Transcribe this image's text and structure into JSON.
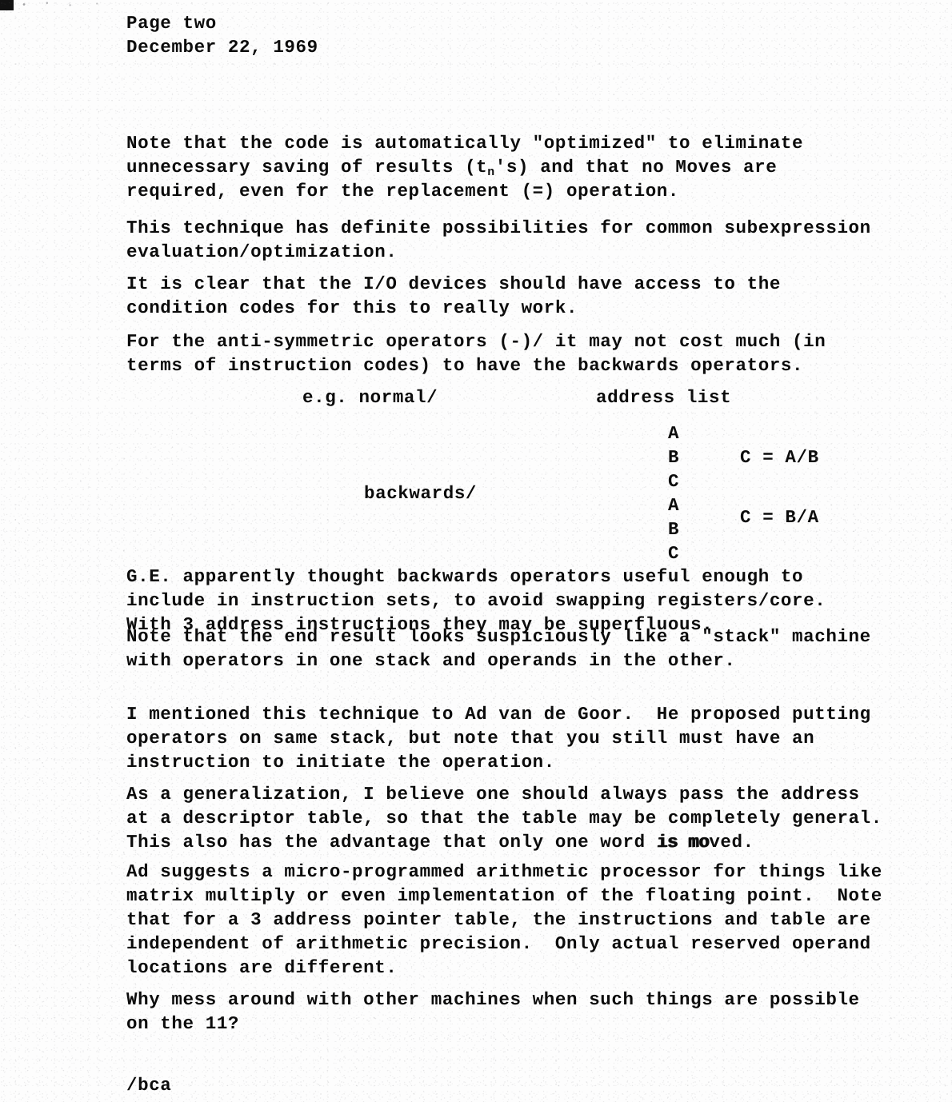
{
  "document": {
    "type": "typewritten-memo-scan",
    "page_label": "Page two",
    "date": "December 22, 1969",
    "signature": "/bca",
    "ink_color": "#0b0b0b",
    "paper_color": "#fdfdfd"
  },
  "header": {
    "line1": "Page two",
    "line2": "December 22, 1969"
  },
  "body": {
    "para_note_line1": "Note that the code is automatically \"optimized\" to eliminate",
    "para_note_line2_a": "unnecessary saving of results (t",
    "para_note_line2_sub": "n",
    "para_note_line2_b": "'s) and that no Moves are",
    "para_note_line3": "required, even for the replacement (=) operation.",
    "para_technique": "This technique has definite possibilities for common subexpression\nevaluation/optimization.",
    "para_io": "It is clear that the I/O devices should have access to the\ncondition codes for this to really work.",
    "para_anti": "For the anti-symmetric operators (-)/ it may not cost much (in\nterms of instruction codes) to have the backwards operators.",
    "para_ge": "G.E. apparently thought backwards operators useful enough to\ninclude in instruction sets, to avoid swapping registers/core.\nWith 3 address instructions they may be superfluous.",
    "para_stack": "Note that the end result looks suspiciously like a \"stack\" machine\nwith operators in one stack and operands in the other.",
    "para_goor": "I mentioned this technique to Ad van de Goor.  He proposed putting\noperators on same stack, but note that you still must have an\ninstruction to initiate the operation.",
    "para_general_line1": "As a generalization, I believe one should always pass the address",
    "para_general_line2": "at a descriptor table, so that the table may be completely general.",
    "para_general_line3_a": "This also has the advantage that only one word ",
    "para_general_line3_strike": "is mo",
    "para_general_line3_b": "ved.",
    "para_ad": "Ad suggests a micro-programmed arithmetic processor for things like\nmatrix multiply or even implementation of the floating point.  Note\nthat for a 3 address pointer table, the instructions and table are\nindependent of arithmetic precision.  Only actual reserved operand\nlocations are different.",
    "para_why": "Why mess around with other machines when such things are possible\non the 11?"
  },
  "example_block": {
    "normal_label": "e.g. normal/",
    "backwards_label": "backwards/",
    "address_list_header": "address list",
    "address_list": "A\nB\nC\nA\nB\nC",
    "result_normal": "C = A/B",
    "result_backwards": "C = B/A"
  }
}
